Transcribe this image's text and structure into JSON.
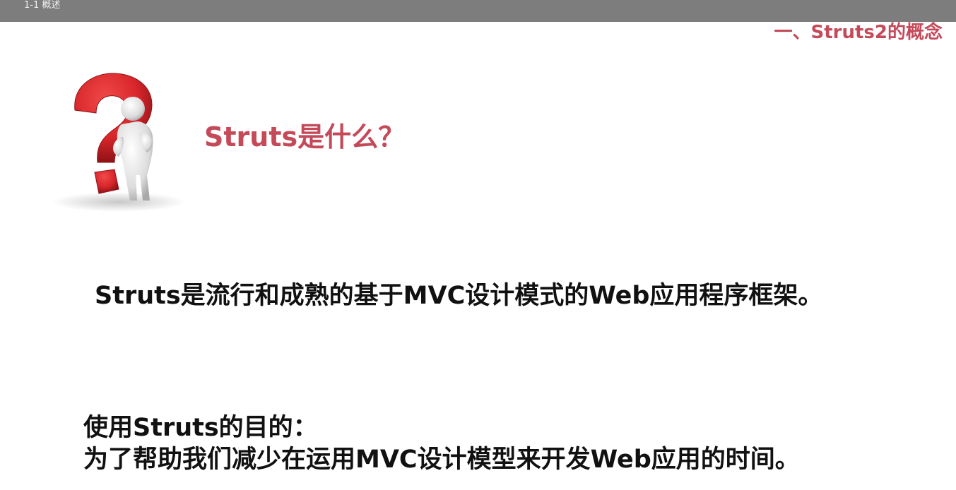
{
  "window": {
    "title": "1-1 概述"
  },
  "slide": {
    "section_heading": "一、Struts2的概念",
    "question_heading": "Struts是什么？",
    "definition": "Struts是流行和成熟的基于MVC设计模式的Web应用程序框架。",
    "purpose_label": "使用Struts的目的：",
    "purpose_text": "为了帮助我们减少在运用MVC设计模型来开发Web应用的时间。",
    "illustration_icon": "question-mark-figure-icon"
  },
  "colors": {
    "title_bar": "#7d7d7d",
    "accent_red": "#c44a5a",
    "question_mark_red": "#d8262b",
    "body_text": "#111111",
    "background": "#ffffff"
  }
}
